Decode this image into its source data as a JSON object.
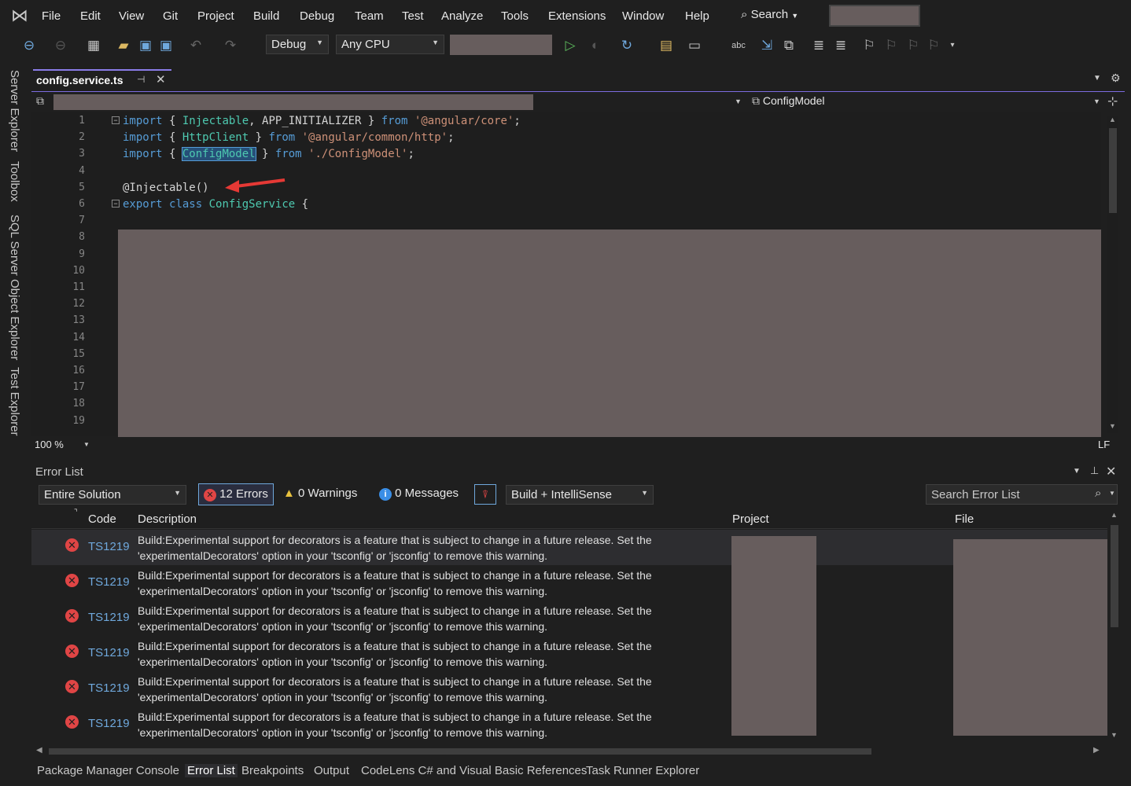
{
  "menu": [
    "File",
    "Edit",
    "View",
    "Git",
    "Project",
    "Build",
    "Debug",
    "Team",
    "Test",
    "Analyze",
    "Tools",
    "Extensions",
    "Window",
    "Help"
  ],
  "search_label": "Search",
  "toolbar": {
    "config": "Debug",
    "platform": "Any CPU"
  },
  "left_tabs": [
    "Server Explorer",
    "Toolbox",
    "SQL Server Object Explorer",
    "Test Explorer"
  ],
  "editor_tab": {
    "filename": "config.service.ts"
  },
  "nav": {
    "member": "ConfigModel"
  },
  "code_lines": [
    {
      "n": "1",
      "parts": [
        [
          "kw",
          "import"
        ],
        [
          "t",
          " { "
        ],
        [
          "cls",
          "Injectable"
        ],
        [
          "t",
          ", APP_INITIALIZER } "
        ],
        [
          "kw",
          "from"
        ],
        [
          "t",
          " "
        ],
        [
          "str",
          "'@angular/core'"
        ],
        [
          "t",
          ";"
        ]
      ]
    },
    {
      "n": "2",
      "parts": [
        [
          "kw",
          "import"
        ],
        [
          "t",
          " { "
        ],
        [
          "cls",
          "HttpClient"
        ],
        [
          "t",
          " } "
        ],
        [
          "kw",
          "from"
        ],
        [
          "t",
          " "
        ],
        [
          "str",
          "'@angular/common/http'"
        ],
        [
          "t",
          ";"
        ]
      ]
    },
    {
      "n": "3",
      "parts": [
        [
          "kw",
          "import"
        ],
        [
          "t",
          " { "
        ],
        [
          "sel",
          "ConfigModel"
        ],
        [
          "t",
          " } "
        ],
        [
          "kw",
          "from"
        ],
        [
          "t",
          " "
        ],
        [
          "str",
          "'./ConfigModel'"
        ],
        [
          "t",
          ";"
        ]
      ]
    },
    {
      "n": "4",
      "parts": []
    },
    {
      "n": "5",
      "parts": [
        [
          "t",
          "@Injectable()"
        ]
      ]
    },
    {
      "n": "6",
      "parts": [
        [
          "kw",
          "export"
        ],
        [
          "t",
          " "
        ],
        [
          "kw",
          "class"
        ],
        [
          "t",
          " "
        ],
        [
          "cls",
          "ConfigService"
        ],
        [
          "t",
          " {"
        ]
      ]
    },
    {
      "n": "7",
      "parts": []
    },
    {
      "n": "8",
      "parts": []
    },
    {
      "n": "9",
      "parts": []
    },
    {
      "n": "10",
      "parts": []
    },
    {
      "n": "11",
      "parts": []
    },
    {
      "n": "12",
      "parts": []
    },
    {
      "n": "13",
      "parts": []
    },
    {
      "n": "14",
      "parts": []
    },
    {
      "n": "15",
      "parts": []
    },
    {
      "n": "16",
      "parts": []
    },
    {
      "n": "17",
      "parts": []
    },
    {
      "n": "18",
      "parts": []
    },
    {
      "n": "19",
      "parts": []
    }
  ],
  "status": {
    "zoom": "100 %",
    "eol": "LF"
  },
  "error_list": {
    "title": "Error List",
    "scope": "Entire Solution",
    "errors_label": "12 Errors",
    "warnings_label": "0 Warnings",
    "messages_label": "0 Messages",
    "source": "Build + IntelliSense",
    "search_placeholder": "Search Error List",
    "columns": {
      "code": "Code",
      "description": "Description",
      "project": "Project",
      "file": "File"
    },
    "rows": [
      {
        "code": "TS1219",
        "desc": "Build:Experimental support for decorators is a feature that is subject to change in a future release. Set the 'experimentalDecorators' option in your 'tsconfig' or 'jsconfig' to remove this warning."
      },
      {
        "code": "TS1219",
        "desc": "Build:Experimental support for decorators is a feature that is subject to change in a future release. Set the 'experimentalDecorators' option in your 'tsconfig' or 'jsconfig' to remove this warning."
      },
      {
        "code": "TS1219",
        "desc": "Build:Experimental support for decorators is a feature that is subject to change in a future release. Set the 'experimentalDecorators' option in your 'tsconfig' or 'jsconfig' to remove this warning."
      },
      {
        "code": "TS1219",
        "desc": "Build:Experimental support for decorators is a feature that is subject to change in a future release. Set the 'experimentalDecorators' option in your 'tsconfig' or 'jsconfig' to remove this warning."
      },
      {
        "code": "TS1219",
        "desc": "Build:Experimental support for decorators is a feature that is subject to change in a future release. Set the 'experimentalDecorators' option in your 'tsconfig' or 'jsconfig' to remove this warning."
      },
      {
        "code": "TS1219",
        "desc": "Build:Experimental support for decorators is a feature that is subject to change in a future release. Set the 'experimentalDecorators' option in your 'tsconfig' or 'jsconfig' to remove this warning."
      }
    ]
  },
  "bottom_tabs": [
    "Package Manager Console",
    "Error List",
    "Breakpoints",
    "Output",
    "CodeLens C# and Visual Basic References",
    "Task Runner Explorer"
  ],
  "colors": {
    "accent": "#8a7ce8",
    "error": "#e04545",
    "redaction": "#675d5d"
  }
}
